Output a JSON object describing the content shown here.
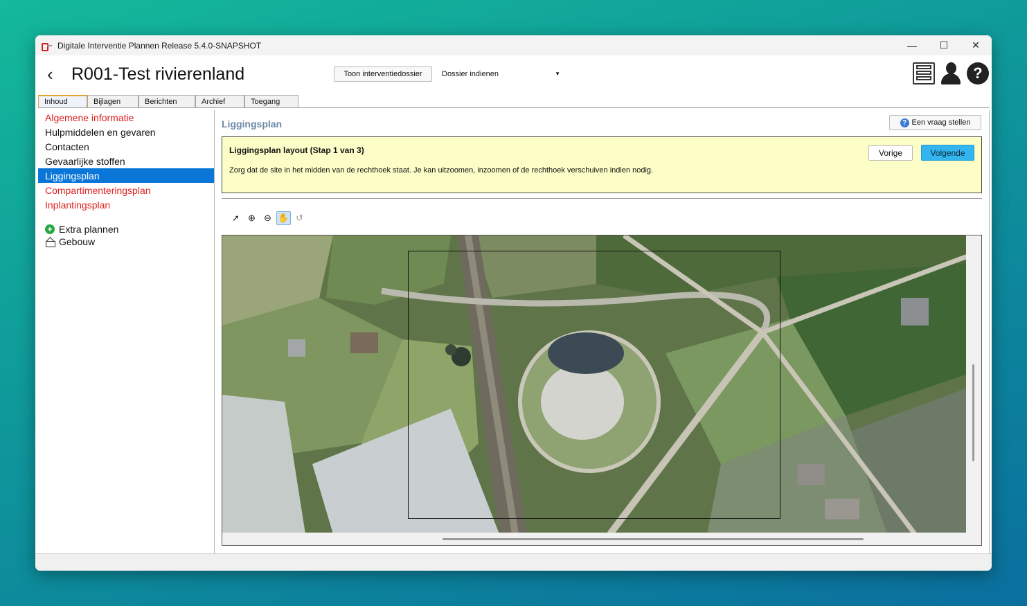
{
  "window": {
    "title": "Digitale Interventie Plannen Release 5.4.0-SNAPSHOT",
    "controls": {
      "minimize": "—",
      "maximize": "☐",
      "close": "✕"
    }
  },
  "header": {
    "back_icon": "‹",
    "title": "R001-Test rivierenland",
    "toon_button": "Toon interventiedossier",
    "dossier_select": "Dossier indienen",
    "help_icon_label": "?"
  },
  "tabs": [
    {
      "label": "Inhoud",
      "active": true
    },
    {
      "label": "Bijlagen",
      "active": false
    },
    {
      "label": "Berichten",
      "active": false
    },
    {
      "label": "Archief",
      "active": false
    },
    {
      "label": "Toegang",
      "active": false
    }
  ],
  "sidebar": {
    "items": [
      {
        "label": "Algemene informatie",
        "state": "red"
      },
      {
        "label": "Hulpmiddelen en gevaren",
        "state": "normal"
      },
      {
        "label": "Contacten",
        "state": "normal"
      },
      {
        "label": "Gevaarlijke stoffen",
        "state": "normal"
      },
      {
        "label": "Liggingsplan",
        "state": "selected"
      },
      {
        "label": "Compartimenteringsplan",
        "state": "red"
      },
      {
        "label": "Inplantingsplan",
        "state": "red"
      }
    ],
    "extra_plannen": "Extra plannen",
    "gebouw": "Gebouw",
    "plus_icon": "+"
  },
  "content": {
    "section_title": "Liggingsplan",
    "vraag_button": "Een vraag stellen",
    "vraag_icon": "?",
    "wizard": {
      "title": "Liggingsplan layout (Stap 1 van 3)",
      "text": "Zorg dat de site in het midden van de rechthoek staat. Je kan uitzoomen, inzoomen of de rechthoek verschuiven indien nodig.",
      "prev_button": "Vorige",
      "next_button": "Volgende"
    },
    "toolbar": {
      "select_tool": "➚",
      "zoom_in_tool": "⊕",
      "zoom_out_tool": "⊖",
      "pan_tool": "✋",
      "undo_tool": "↺"
    }
  },
  "colors": {
    "accent": "#0a77d8",
    "warning_red": "#e02020",
    "wizard_bg": "#fdfdc8",
    "primary_button": "#33b5ef",
    "section_title": "#6b8aa6"
  }
}
